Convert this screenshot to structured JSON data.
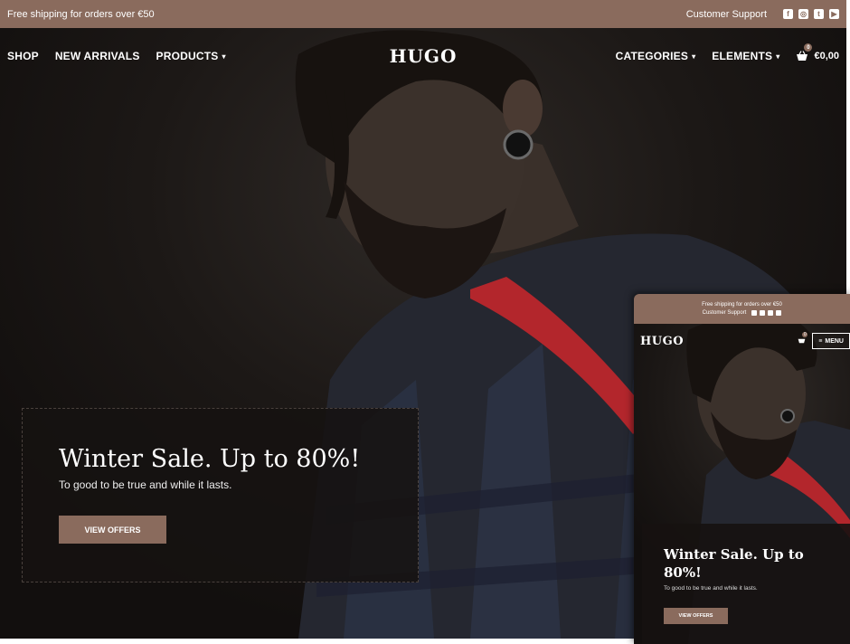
{
  "desktop": {
    "topbar": {
      "shipping_text": "Free shipping for orders over €50",
      "support_label": "Customer Support",
      "social_icons": [
        "facebook-icon",
        "instagram-icon",
        "twitter-icon",
        "youtube-icon"
      ]
    },
    "nav": {
      "left": [
        {
          "label": "SHOP",
          "caret": false
        },
        {
          "label": "NEW ARRIVALS",
          "caret": false
        },
        {
          "label": "PRODUCTS",
          "caret": true
        }
      ],
      "logo": "HUGO",
      "right": [
        {
          "label": "CATEGORIES",
          "caret": true
        },
        {
          "label": "ELEMENTS",
          "caret": true
        }
      ],
      "cart_count": "0",
      "cart_total": "€0,00"
    },
    "hero": {
      "title": "Winter Sale. Up to 80%!",
      "subtitle": "To good to be true and while it lasts.",
      "button_label": "VIEW OFFERS"
    }
  },
  "mobile": {
    "topbar": {
      "shipping_text": "Free shipping for orders over €50",
      "support_label": "Customer Support"
    },
    "nav": {
      "logo": "HUGO",
      "cart_count": "0",
      "menu_label": "MENU"
    },
    "hero": {
      "title": "Winter Sale. Up to 80%!",
      "subtitle": "To good to be true and while it lasts.",
      "button_label": "VIEW OFFERS"
    }
  },
  "colors": {
    "accent": "#8a6b5d",
    "background": "#151212",
    "suspender": "#b3262c"
  }
}
